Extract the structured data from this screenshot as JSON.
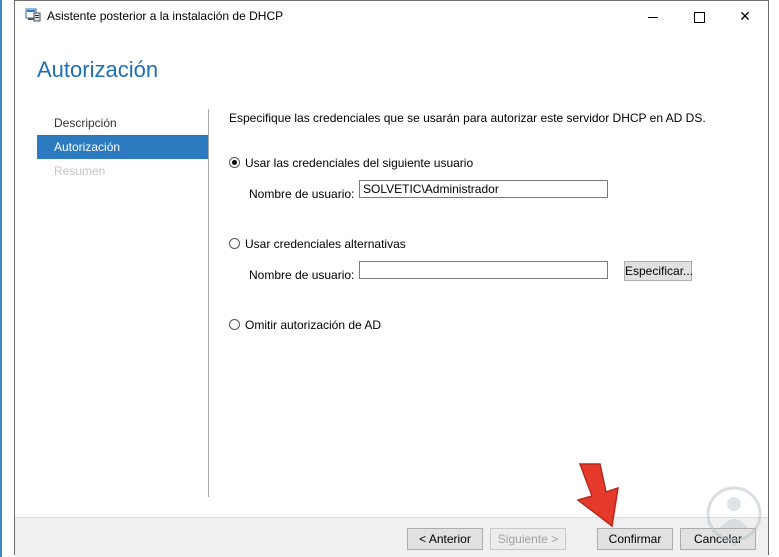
{
  "window": {
    "title": "Asistente posterior a la instalación de DHCP",
    "icon": "dhcp-app-icon",
    "controls": {
      "minimize": "minimize-icon",
      "maximize": "maximize-icon",
      "close": "close-icon"
    }
  },
  "page": {
    "title": "Autorización"
  },
  "nav": {
    "items": [
      {
        "label": "Descripción",
        "state": "normal"
      },
      {
        "label": "Autorización",
        "state": "active"
      },
      {
        "label": "Resumen",
        "state": "disabled"
      }
    ]
  },
  "content": {
    "description": "Especifique las credenciales que se usarán para autorizar este servidor DHCP en AD DS.",
    "option_current": {
      "label": "Usar las credenciales del siguiente usuario",
      "checked": true,
      "username_label": "Nombre de usuario:",
      "username_value": "SOLVETIC\\Administrador"
    },
    "option_alternate": {
      "label": "Usar credenciales alternativas",
      "checked": false,
      "username_label": "Nombre de usuario:",
      "username_value": "",
      "specify_button": "Especificar..."
    },
    "option_skip": {
      "label": "Omitir autorización de AD",
      "checked": false
    }
  },
  "footer": {
    "previous": "< Anterior",
    "next": "Siguiente >",
    "confirm": "Confirmar",
    "cancel": "Cancelar"
  },
  "colors": {
    "accent": "#2b79bf",
    "title": "#1f6fb4",
    "arrow": "#e5392b"
  }
}
